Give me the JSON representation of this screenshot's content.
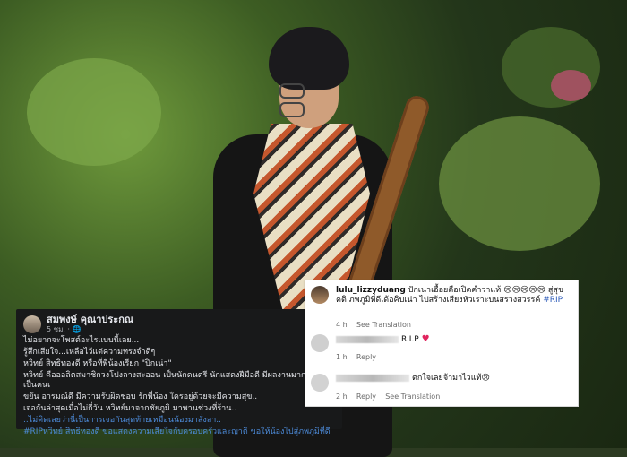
{
  "facebook_post": {
    "author": "สมพงษ์ คุณาประกณ",
    "time": "5 ชม. · 🌐",
    "lines": [
      "ไม่อยากจะโพสต์อะไรแบบนี้เลย...",
      "รู้สึกเสียใจ...เหลือไว้แต่ความทรงจำดีๆ",
      "หวิทย์ สิทธิทองดี หรือที่พี่น้องเรียก \"ปิกเน่า\"",
      "หวิทย์ คือออลิตสมาชิกวงโปงลางสะออน เป็นนักดนตรี นักแสดงฝีมือดี มีผลงานมากมาย เป็นคนเ",
      "ขยัน อารมณ์ดี มีความรับผิดชอบ รักพี่น้อง ใครอยู่ด้วยจะมีความสุข..",
      "เจอกันล่าสุดเมื่อไม่กี่วัน หวิทย์มาจากชัยภูมิ มาพานช่วงที่ร้าน..",
      "..ไม่คิดเลยว่านี่เป็นการเจอกันสุดท้ายเหมือนน้องมาสั่งลา..",
      "#RIPหวิทย์ สิทธิทองดี ขอแสดงความเสียใจกับครอบครัวและญาติ ขอให้น้องไปสู่ภพภูมิที่ดี"
    ]
  },
  "comments": [
    {
      "username": "lulu_lizzyduang",
      "text": " ปักเน่าเอื้อยคือเปิดคำว่าแท้ 😢😢😢😢😢 สู่สุขคติ ภพภูมิที่ดีเด้อคิบเน่า ไปสร้างเสียงหัวเราะบนสรวงสวรรค์ ",
      "hashtag": "#RIP",
      "time": "4 h",
      "action": "See Translation"
    },
    {
      "text": "R.I.P",
      "time": "1 h",
      "action": "Reply"
    },
    {
      "text": "ตกใจเลยจ้ามาไวแท้😢",
      "time": "2 h",
      "action": "Reply",
      "action2": "See Translation"
    }
  ]
}
